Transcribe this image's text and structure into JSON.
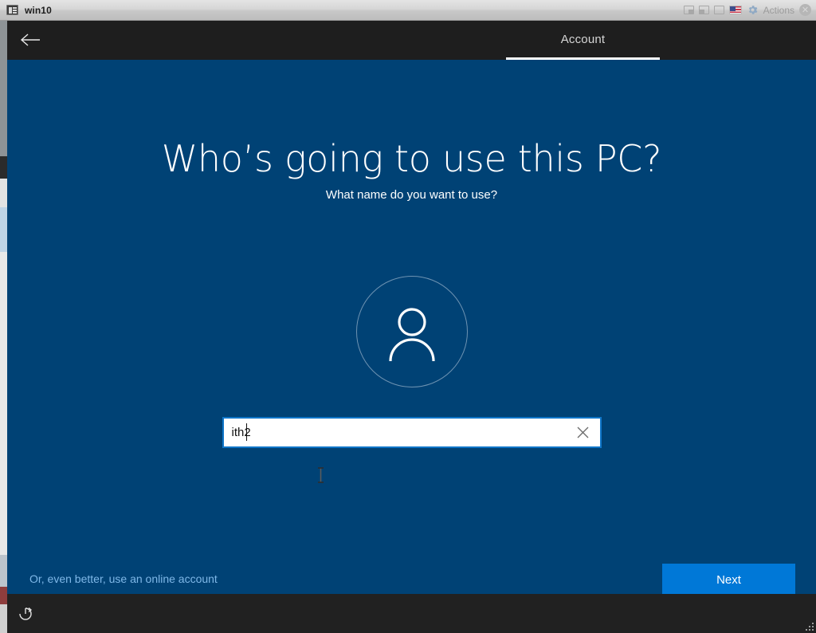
{
  "vm_window": {
    "title": "win10",
    "icon": "monitor-icon",
    "controls": {
      "scale_mode_icon": "window-scale-icon",
      "fullscreen_icon": "window-fullscreen-icon",
      "seamless_icon": "window-seamless-icon",
      "keyboard_layout_icon": "us-flag-icon",
      "gear_icon": "gear-icon",
      "actions_label": "Actions",
      "close_icon": "close-icon"
    }
  },
  "oobe": {
    "header": {
      "back_icon": "back-arrow-icon",
      "tab_label": "Account"
    },
    "headline": "Who’s going to use this PC?",
    "subhead": "What name do you want to use?",
    "avatar_icon": "user-avatar-icon",
    "name_field": {
      "value": "ith2",
      "placeholder": "",
      "clear_icon": "close-icon"
    },
    "cursor_icon": "i-beam-cursor",
    "online_account_link": "Or, even better, use an online account",
    "next_button": "Next",
    "taskbar": {
      "ease_of_access_icon": "power-ease-of-access-icon"
    },
    "resize_grip_icon": "resize-grip-icon"
  },
  "colors": {
    "oobe_background": "#004275",
    "header_background": "#1e1e1e",
    "accent_button": "#0078d7",
    "link": "#7fb8e8",
    "field_border": "#0e75c8"
  }
}
